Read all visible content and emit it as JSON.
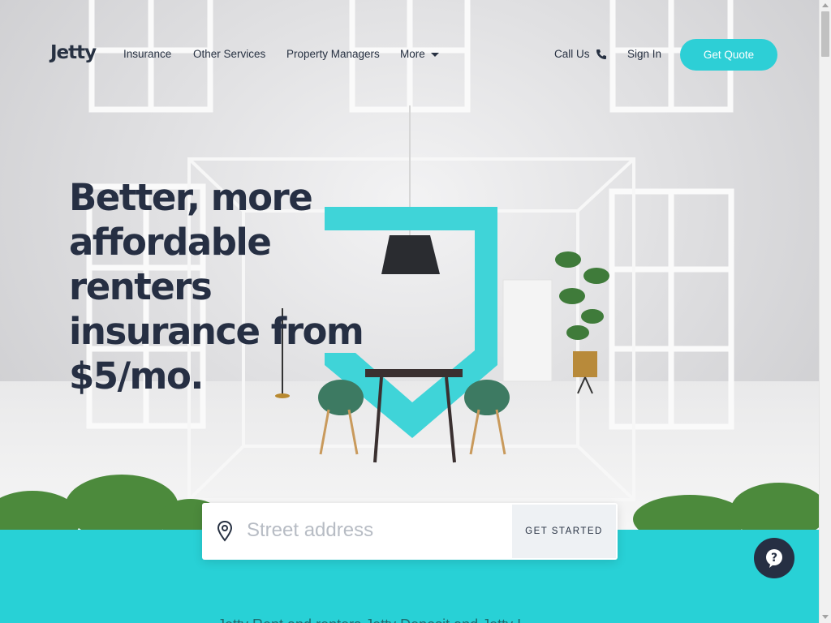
{
  "brand": {
    "logo_text": "Jetty",
    "accent_color": "#2dcfd6",
    "dark_color": "#262f43"
  },
  "nav": {
    "links": [
      "Insurance",
      "Other Services",
      "Property Managers",
      "More"
    ],
    "call_us": "Call Us",
    "sign_in": "Sign In",
    "get_quote": "Get Quote"
  },
  "hero": {
    "headline": "Better, more affordable renters insurance from $5/mo."
  },
  "search": {
    "placeholder": "Street address",
    "button_label": "GET STARTED"
  },
  "band": {
    "partial_text": "Jetty Rent and renters Jetty Deposit and Jetty I..."
  },
  "icons": {
    "phone": "phone-icon",
    "pin": "location-pin-icon",
    "help": "help-question-icon",
    "caret": "chevron-down-icon"
  }
}
